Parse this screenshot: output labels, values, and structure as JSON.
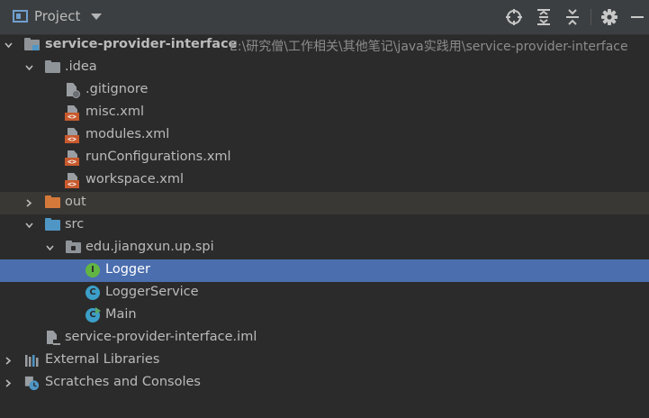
{
  "header": {
    "title": "Project",
    "icons": [
      "project-panel-icon",
      "dropdown-icon",
      "locate-icon",
      "expand-all-icon",
      "collapse-all-icon",
      "gear-icon",
      "hide-icon"
    ]
  },
  "tree": {
    "root_label": "service-provider-interface",
    "root_path": "E:\\研究僧\\工作相关\\其他笔记\\java实践用\\service-provider-interface",
    "idea_folder": ".idea",
    "idea_files": [
      ".gitignore",
      "misc.xml",
      "modules.xml",
      "runConfigurations.xml",
      "workspace.xml"
    ],
    "out_folder": "out",
    "src_folder": "src",
    "package": "edu.jiangxun.up.spi",
    "classes": [
      "Logger",
      "LoggerService",
      "Main"
    ],
    "iml_file": "service-provider-interface.iml",
    "external_libraries": "External Libraries",
    "scratches": "Scratches and Consoles"
  },
  "colors": {
    "background": "#2b2b2b",
    "header": "#3c3f41",
    "selection": "#4b6eaf",
    "excluded_row": "#3a3834",
    "interface_icon": "#62b543",
    "class_icon": "#3c9fc9",
    "xml_badge": "#c85a2e"
  }
}
